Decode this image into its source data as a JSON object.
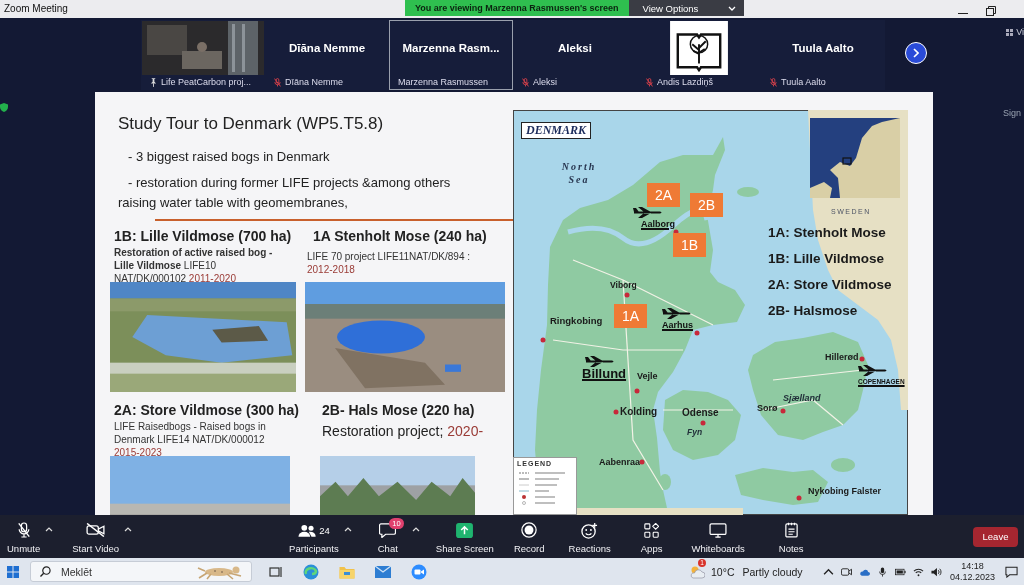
{
  "title_bar": {
    "title": "Zoom Meeting",
    "banner": "You are viewing Marzenna Rasmussen's screen",
    "view_options": "View Options"
  },
  "participants": [
    {
      "kind": "video",
      "label": "Life PeatCarbon proj...",
      "pinned": true,
      "muted": false,
      "selected": false
    },
    {
      "kind": "name",
      "name": "Dīāna Nemme",
      "label": "Dīāna Nemme",
      "pinned": false,
      "muted": true,
      "selected": false
    },
    {
      "kind": "name",
      "name": "Marzenna Rasm...",
      "label": "Marzenna Rasmussen",
      "pinned": false,
      "muted": false,
      "selected": true
    },
    {
      "kind": "name",
      "name": "Aleksi",
      "label": "Aleksi",
      "pinned": false,
      "muted": true,
      "selected": false
    },
    {
      "kind": "logo",
      "label": "Andis Lazdiņš",
      "pinned": false,
      "muted": true,
      "selected": false
    },
    {
      "kind": "name",
      "name": "Tuula Aalto",
      "label": "Tuula Aalto",
      "pinned": false,
      "muted": true,
      "selected": false
    }
  ],
  "view_toggle": "Vi",
  "side_text": "Sign",
  "slide": {
    "title": "Study Tour to Denmark (WP5.T5.8)",
    "bullets": [
      "- 3 biggest raised bogs in Denmark",
      "- restoration during former LIFE projects &among others raising water table with geomembranes,"
    ],
    "sites": [
      {
        "kind": "note",
        "heading": "1B: Lille Vildmose (700 ha)",
        "description": "**Restoration of active raised bog - Lille Vildmose** LIFE10 NAT/DK/000102",
        "years": "2011-2020"
      },
      {
        "kind": "note",
        "heading": "1A Stenholt Mose (240 ha)",
        "description": "LIFE 70 project LIFE11NAT/DK/894 :",
        "years": "2012-2018"
      },
      {
        "kind": "note",
        "heading": "2A: Store Vildmose (300 ha)",
        "description": "LIFE Raisedbogs - Raised bogs in Denmark LIFE14 NAT/DK/000012",
        "years": "2015-2023"
      },
      {
        "kind": "line",
        "heading": "2B- Hals Mose (220 ha)",
        "description": "Restoration project;",
        "years": "2020-"
      }
    ],
    "map": {
      "title": "DENMARK",
      "labels": [
        {
          "kind": "sea",
          "text": "North Sea"
        },
        {
          "kind": "country",
          "text": "SWEDEN"
        },
        {
          "kind": "airport",
          "text": "Aalborg"
        },
        {
          "kind": "city",
          "text": "Viborg"
        },
        {
          "kind": "city",
          "text": "Ringkobing"
        },
        {
          "kind": "airport",
          "text": "Aarhus"
        },
        {
          "kind": "airport",
          "text": "Billund"
        },
        {
          "kind": "city",
          "text": "Vejle"
        },
        {
          "kind": "city",
          "text": "Kolding"
        },
        {
          "kind": "city",
          "text": "Odense"
        },
        {
          "kind": "region",
          "text": "Fyn"
        },
        {
          "kind": "region",
          "text": "Sjælland"
        },
        {
          "kind": "city",
          "text": "Sorø"
        },
        {
          "kind": "city",
          "text": "Hillerød"
        },
        {
          "kind": "airport",
          "text": "COPENHAGEN"
        },
        {
          "kind": "city",
          "text": "Aabenraa"
        },
        {
          "kind": "city",
          "text": "Nykobing Falster"
        }
      ],
      "markers": [
        "2A",
        "2B",
        "1B",
        "1A"
      ],
      "key": [
        "1A: Stenholt Mose",
        "1B: Lille Vildmose",
        "2A: Store Vildmose",
        "2B- Halsmose"
      ],
      "legend_title": "LEGEND"
    }
  },
  "toolbar": {
    "items": [
      {
        "kind": "mic",
        "label": "Unmute",
        "caret": true
      },
      {
        "kind": "video",
        "label": "Start Video",
        "caret": true
      },
      {
        "kind": "participants",
        "label": "Participants",
        "count": "24",
        "caret": true
      },
      {
        "kind": "chat",
        "label": "Chat",
        "badge": "10",
        "caret": true
      },
      {
        "kind": "share",
        "label": "Share Screen",
        "caret": false
      },
      {
        "kind": "record",
        "label": "Record",
        "caret": false
      },
      {
        "kind": "reactions",
        "label": "Reactions",
        "caret": false
      },
      {
        "kind": "apps",
        "label": "Apps",
        "caret": false
      },
      {
        "kind": "whiteboards",
        "label": "Whiteboards",
        "caret": false
      },
      {
        "kind": "notes",
        "label": "Notes",
        "caret": false
      }
    ],
    "leave": "Leave"
  },
  "taskbar": {
    "search": {
      "placeholder": "Meklēt"
    },
    "weather": {
      "badge": "1",
      "temperature": "10°C",
      "condition": "Partly cloudy"
    },
    "clock": {
      "time": "14:18",
      "date": "04.12.2023"
    }
  }
}
